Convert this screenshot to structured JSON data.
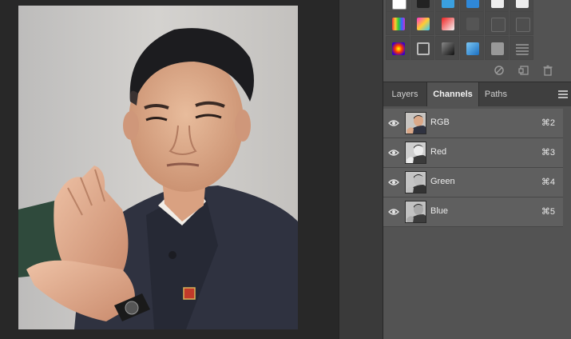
{
  "panel": {
    "tabs": [
      {
        "label": "Layers",
        "active": false
      },
      {
        "label": "Channels",
        "active": true
      },
      {
        "label": "Paths",
        "active": false
      }
    ],
    "menu_icon": "panel-menu-icon",
    "footer_icons": [
      "no-entry-icon",
      "new-item-icon",
      "trash-icon"
    ]
  },
  "channels": [
    {
      "name": "RGB",
      "shortcut": "⌘2",
      "visible": true
    },
    {
      "name": "Red",
      "shortcut": "⌘3",
      "visible": true
    },
    {
      "name": "Green",
      "shortcut": "⌘4",
      "visible": true
    },
    {
      "name": "Blue",
      "shortcut": "⌘5",
      "visible": true
    }
  ],
  "colors": {
    "panel_bg": "#535353",
    "row_bg": "#5f5f5f",
    "tab_bar_bg": "#3f3f3f",
    "canvas_bg": "#282828"
  }
}
